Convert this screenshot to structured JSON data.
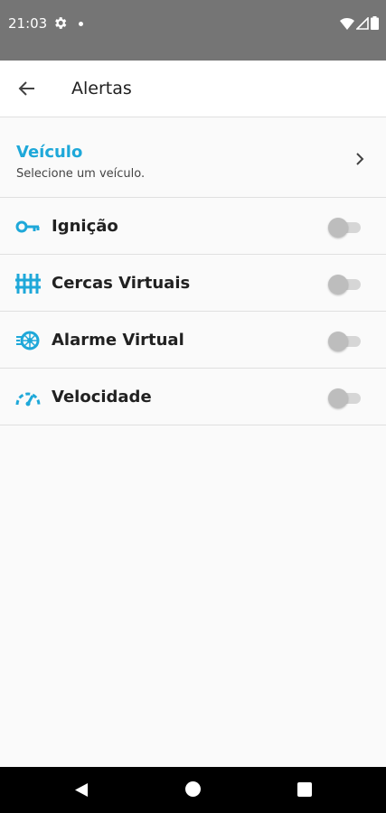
{
  "status_bar": {
    "time": "21:03"
  },
  "app_bar": {
    "title": "Alertas"
  },
  "vehicle": {
    "title": "Veículo",
    "subtitle": "Selecione um veículo."
  },
  "alerts": [
    {
      "label": "Ignição",
      "icon": "key-icon",
      "enabled": false
    },
    {
      "label": "Cercas Virtuais",
      "icon": "fence-icon",
      "enabled": false
    },
    {
      "label": "Alarme Virtual",
      "icon": "alarm-wheel-icon",
      "enabled": false
    },
    {
      "label": "Velocidade",
      "icon": "speedometer-icon",
      "enabled": false
    }
  ],
  "colors": {
    "accent": "#1ea8d9",
    "status_bar": "#757575",
    "toggle_off": "#bdbdbd"
  }
}
